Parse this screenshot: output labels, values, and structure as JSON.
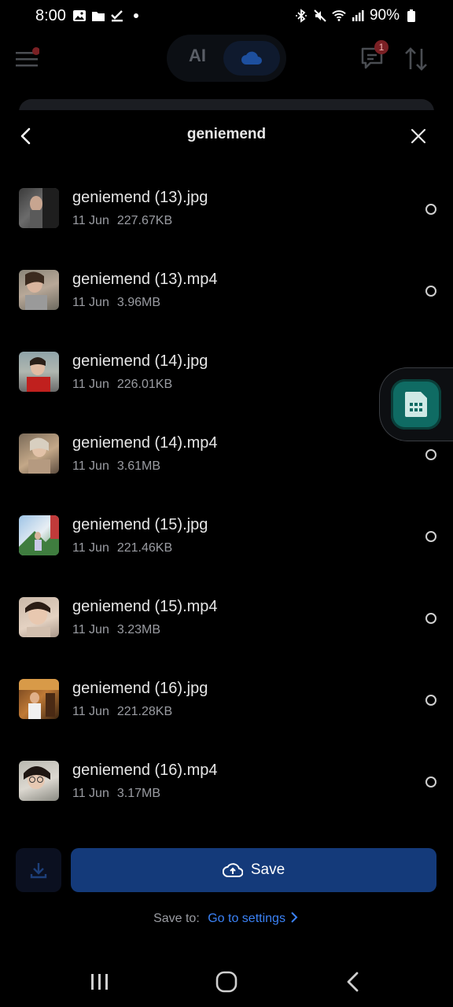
{
  "status_bar": {
    "time": "8:00",
    "battery": "90%",
    "left_icons": [
      "image-icon",
      "folder-icon",
      "check-icon",
      "dot-icon"
    ],
    "right_icons": [
      "bluetooth-icon",
      "mute-icon",
      "wifi-icon",
      "signal-icon",
      "battery-icon"
    ]
  },
  "background": {
    "toggle_ai": "AI",
    "message_badge": "1"
  },
  "sheet": {
    "title": "geniemend"
  },
  "files": [
    {
      "name": "geniemend (13).jpg",
      "date": "11 Jun",
      "size": "227.67KB"
    },
    {
      "name": "geniemend (13).mp4",
      "date": "11 Jun",
      "size": "3.96MB"
    },
    {
      "name": "geniemend (14).jpg",
      "date": "11 Jun",
      "size": "226.01KB"
    },
    {
      "name": "geniemend (14).mp4",
      "date": "11 Jun",
      "size": "3.61MB"
    },
    {
      "name": "geniemend (15).jpg",
      "date": "11 Jun",
      "size": "221.46KB"
    },
    {
      "name": "geniemend (15).mp4",
      "date": "11 Jun",
      "size": "3.23MB"
    },
    {
      "name": "geniemend (16).jpg",
      "date": "11 Jun",
      "size": "221.28KB"
    },
    {
      "name": "geniemend (16).mp4",
      "date": "11 Jun",
      "size": "3.17MB"
    }
  ],
  "actions": {
    "save_label": "Save",
    "save_to_label": "Save to:",
    "settings_link": "Go to settings"
  },
  "colors": {
    "background": "#000000",
    "accent_button": "#143a7a",
    "link": "#3b82f6",
    "floating_widget": "#0f6b63"
  }
}
